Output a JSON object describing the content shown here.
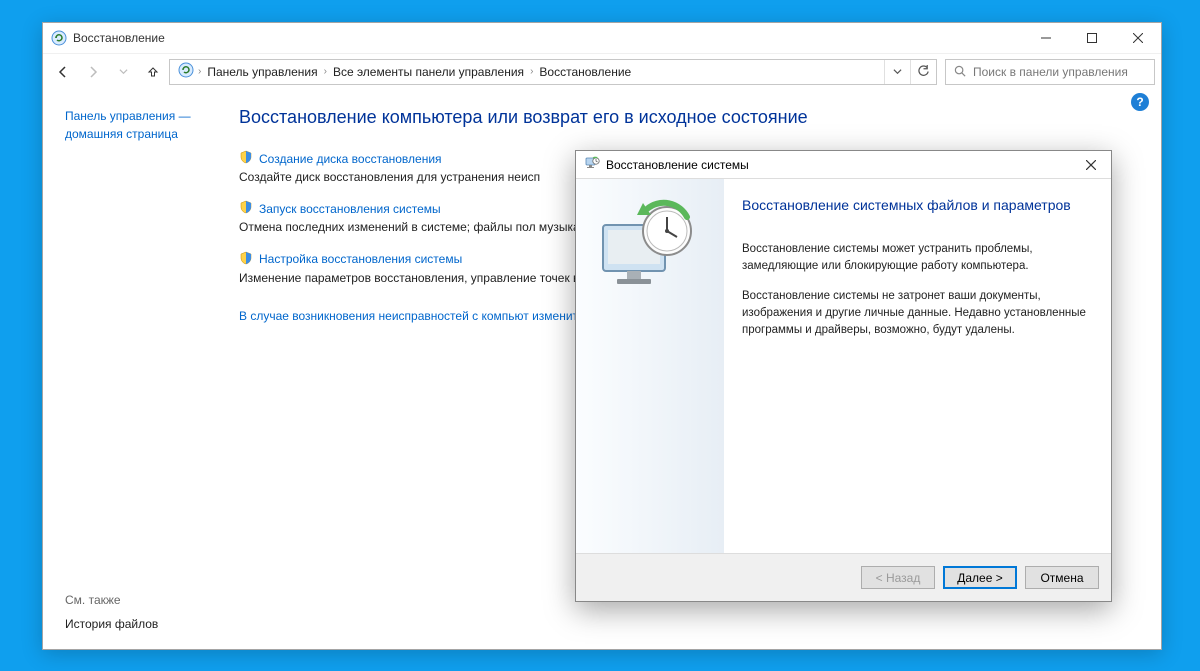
{
  "window": {
    "title": "Восстановление"
  },
  "addrbar": {
    "crumb1": "Панель управления",
    "crumb2": "Все элементы панели управления",
    "crumb3": "Восстановление"
  },
  "search": {
    "placeholder": "Поиск в панели управления"
  },
  "sidebar": {
    "cp_home_line1": "Панель управления —",
    "cp_home_line2": "домашняя страница",
    "see_also": "См. также",
    "history": "История файлов"
  },
  "main": {
    "heading": "Восстановление компьютера или возврат его в исходное состояние",
    "items": [
      {
        "link": "Создание диска восстановления",
        "desc": "Создайте диск восстановления для устранения неисп"
      },
      {
        "link": "Запуск восстановления системы",
        "desc": "Отмена последних изменений в системе; файлы пол музыка, остаются без изменений."
      },
      {
        "link": "Настройка восстановления системы",
        "desc": "Изменение параметров восстановления, управление точек восстановления."
      }
    ],
    "trouble": "В случае возникновения неисправностей с компьют изменить их."
  },
  "dialog": {
    "title": "Восстановление системы",
    "heading": "Восстановление системных файлов и параметров",
    "p1": "Восстановление системы может устранить проблемы, замедляющие или блокирующие работу компьютера.",
    "p2": "Восстановление системы не затронет ваши документы, изображения и другие личные данные. Недавно установленные программы и драйверы, возможно, будут удалены.",
    "back": "< Назад",
    "next": "Далее >",
    "cancel": "Отмена"
  }
}
